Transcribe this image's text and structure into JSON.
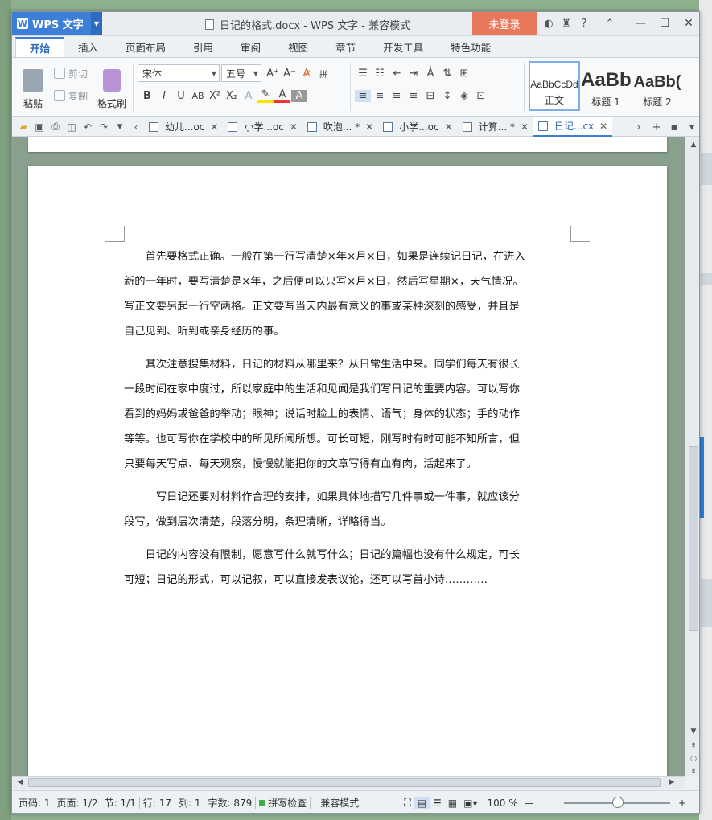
{
  "app": {
    "name": "WPS 文字",
    "window_title": "日记的格式.docx - WPS 文字 - 兼容模式",
    "login_label": "未登录"
  },
  "ribbon_tabs": [
    "开始",
    "插入",
    "页面布局",
    "引用",
    "审阅",
    "视图",
    "章节",
    "开发工具",
    "特色功能"
  ],
  "clipboard": {
    "paste": "粘贴",
    "cut": "剪切",
    "copy": "复制",
    "format_painter": "格式刷"
  },
  "font": {
    "family": "宋体",
    "size": "五号"
  },
  "styles": [
    {
      "preview": "AaBbCcDd",
      "name": "正文"
    },
    {
      "preview": "AaBb",
      "name": "标题 1"
    },
    {
      "preview": "AaBb(",
      "name": "标题 2"
    }
  ],
  "doc_tabs": [
    {
      "label": "幼儿...oc",
      "active": false
    },
    {
      "label": "小学...oc",
      "active": false
    },
    {
      "label": "吹泡... *",
      "active": false
    },
    {
      "label": "小学...oc",
      "active": false
    },
    {
      "label": "计算... *",
      "active": false
    },
    {
      "label": "日记...cx",
      "active": true
    }
  ],
  "document": {
    "paragraphs": [
      "首先要格式正确。一般在第一行写清楚×年×月×日，如果是连续记日记，在进入新的一年时，要写清楚是×年，之后便可以只写×月×日，然后写星期×，天气情况。写正文要另起一行空两格。正文要写当天内最有意义的事或某种深刻的感受，并且是自己见到、听到或亲身经历的事。",
      "其次注意搜集材料，日记的材料从哪里来？从日常生活中来。同学们每天有很长一段时间在家中度过，所以家庭中的生活和见闻是我们写日记的重要内容。可以写你看到的妈妈或爸爸的举动；眼神；说话时脸上的表情、语气；身体的状态；手的动作等等。也可写你在学校中的所见所闻所想。可长可短，刚写时有时可能不知所言，但只要每天写点、每天观察，慢慢就能把你的文章写得有血有肉，活起来了。",
      "写日记还要对材料作合理的安排，如果具体地描写几件事或一件事，就应该分段写，做到层次清楚，段落分明，条理清晰，详略得当。",
      "日记的内容没有限制，愿意写什么就写什么；日记的篇幅也没有什么规定，可长可短；日记的形式，可以记叙，可以直接发表议论，还可以写首小诗…………"
    ]
  },
  "status": {
    "page_code": "页码: 1",
    "page": "页面: 1/2",
    "section": "节: 1/1",
    "row": "行: 17",
    "column": "列: 1",
    "word_count": "字数: 879",
    "spell_check": "拼写检查",
    "compat_mode": "兼容模式",
    "zoom": "100 %"
  },
  "colors": {
    "accent": "#3d7fd6",
    "login_bg": "#e9785a",
    "spell_ok": "#3fae49"
  }
}
